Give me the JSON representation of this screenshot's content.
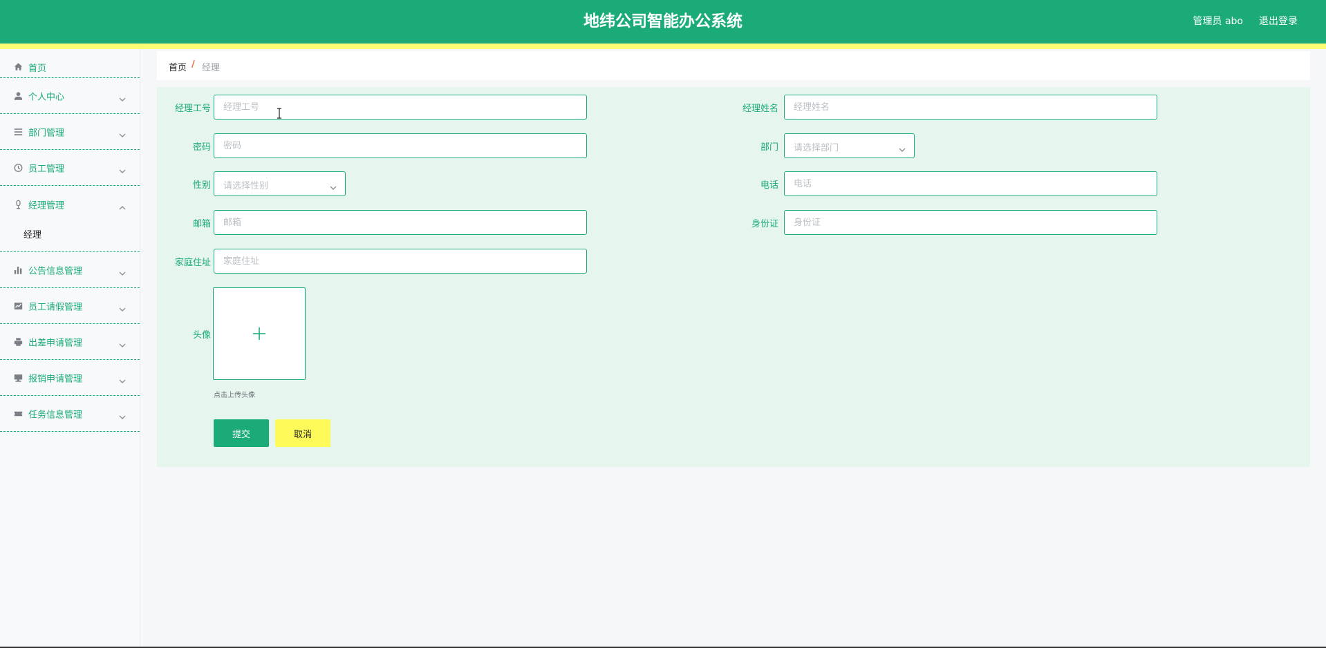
{
  "header": {
    "title": "地纬公司智能办公系统",
    "user_label": "管理员 abo",
    "logout_label": "退出登录",
    "bg_color": "#1aab78",
    "stripe_color": "#fdfa76"
  },
  "sidebar": {
    "items": [
      {
        "label": "首页",
        "icon": "home-icon"
      },
      {
        "label": "个人中心",
        "icon": "user-icon"
      },
      {
        "label": "部门管理",
        "icon": "menu-lines-icon"
      },
      {
        "label": "员工管理",
        "icon": "clock-icon"
      },
      {
        "label": "经理管理",
        "icon": "microphone-icon",
        "expanded": true,
        "children": [
          {
            "label": "经理"
          }
        ]
      },
      {
        "label": "公告信息管理",
        "icon": "bar-chart-icon"
      },
      {
        "label": "员工请假管理",
        "icon": "line-chart-icon"
      },
      {
        "label": "出差申请管理",
        "icon": "printer-icon"
      },
      {
        "label": "报销申请管理",
        "icon": "monitor-icon"
      },
      {
        "label": "任务信息管理",
        "icon": "ticket-icon"
      }
    ]
  },
  "breadcrumb": {
    "home": "首页",
    "separator": "/",
    "current": "经理"
  },
  "form": {
    "manager_id": {
      "label": "经理工号",
      "placeholder": "经理工号",
      "value": ""
    },
    "manager_name": {
      "label": "经理姓名",
      "placeholder": "经理姓名",
      "value": ""
    },
    "password": {
      "label": "密码",
      "placeholder": "密码",
      "value": ""
    },
    "department": {
      "label": "部门",
      "placeholder": "请选择部门"
    },
    "gender": {
      "label": "性别",
      "placeholder": "请选择性别"
    },
    "phone": {
      "label": "电话",
      "placeholder": "电话",
      "value": ""
    },
    "email": {
      "label": "邮箱",
      "placeholder": "邮箱",
      "value": ""
    },
    "id_card": {
      "label": "身份证",
      "placeholder": "身份证",
      "value": ""
    },
    "address": {
      "label": "家庭住址",
      "placeholder": "家庭住址",
      "value": ""
    },
    "avatar": {
      "label": "头像",
      "tip": "点击上传头像"
    },
    "submit_label": "提交",
    "cancel_label": "取消"
  }
}
